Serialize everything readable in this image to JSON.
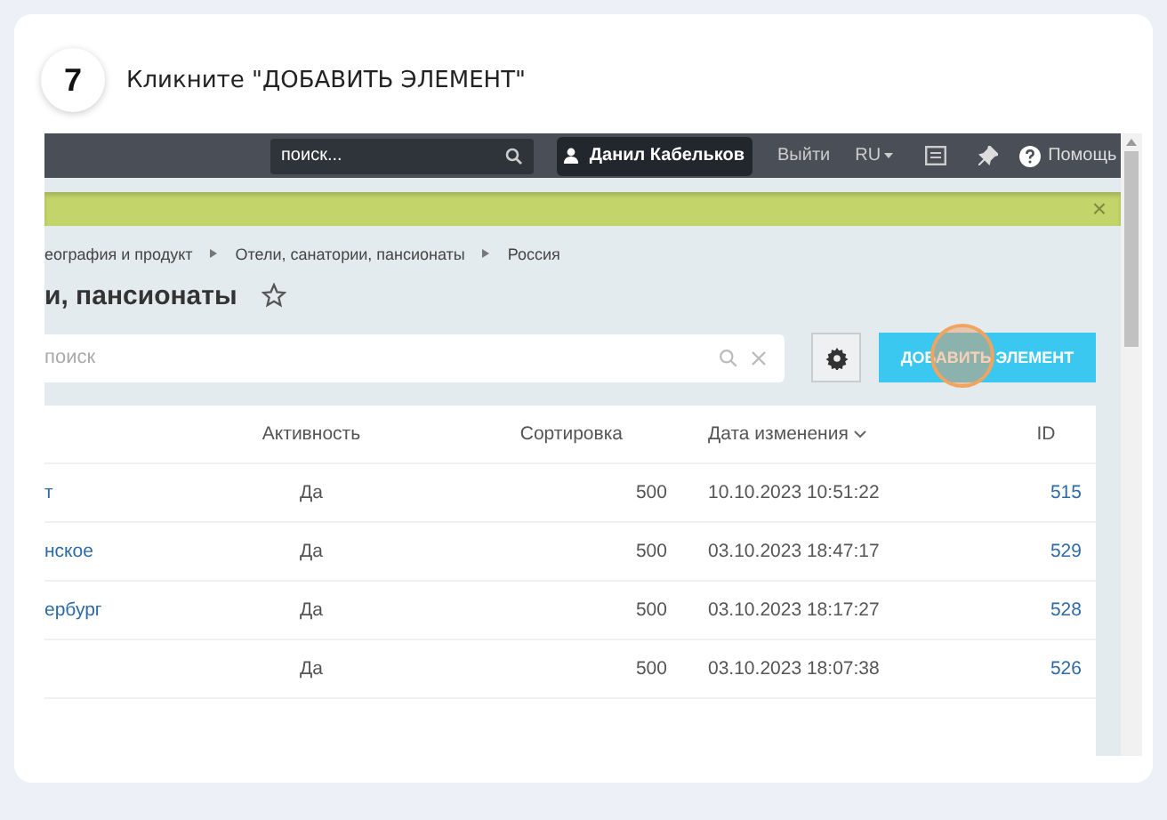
{
  "step": {
    "number": "7",
    "instruction": "Кликните \"ДОБАВИТЬ ЭЛЕМЕНТ\""
  },
  "topbar": {
    "search_placeholder": "поиск...",
    "user": "Данил Кабельков",
    "logout": "Выйти",
    "language": "RU",
    "help": "Помощь"
  },
  "notice": {
    "close": "×"
  },
  "breadcrumbs": [
    "еография и продукт",
    "Отели, санатории, пансионаты",
    "Россия"
  ],
  "page_title": "и, пансионаты",
  "filter": {
    "placeholder": "поиск",
    "add_button": "ДОБАВИТЬ ЭЛЕМЕНТ",
    "highlighted": true
  },
  "table": {
    "columns": [
      "Активность",
      "Сортировка",
      "Дата изменения",
      "ID"
    ],
    "rows": [
      {
        "name": "т",
        "active": "Да",
        "sort": "500",
        "date": "10.10.2023 10:51:22",
        "id": "515"
      },
      {
        "name": "нское",
        "active": "Да",
        "sort": "500",
        "date": "03.10.2023 18:47:17",
        "id": "529"
      },
      {
        "name": "ербург",
        "active": "Да",
        "sort": "500",
        "date": "03.10.2023 18:17:27",
        "id": "528"
      },
      {
        "name": "",
        "active": "Да",
        "sort": "500",
        "date": "03.10.2023 18:07:38",
        "id": "526"
      }
    ]
  }
}
